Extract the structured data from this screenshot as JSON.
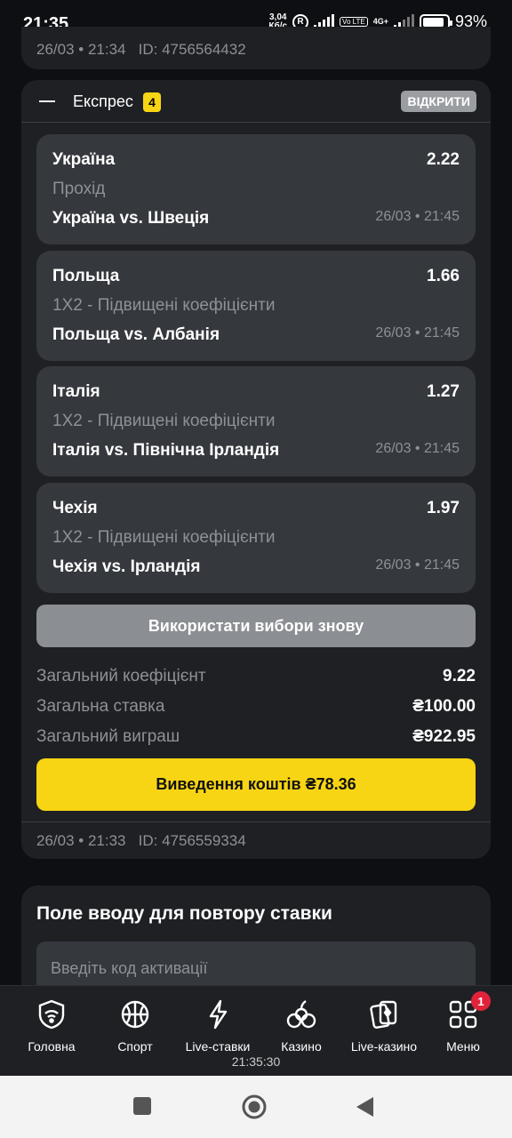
{
  "status_bar": {
    "time": "21:35",
    "speed_value": "3,04",
    "speed_unit": "Кб/с",
    "volte": "Vo LTE",
    "network": "4G+",
    "battery": "93%"
  },
  "previous_bet": {
    "date": "26/03 • 21:34",
    "id": "ID: 4756564432"
  },
  "express_card": {
    "title": "Експрес",
    "count": "4",
    "open_label": "ВІДКРИТИ",
    "selections": [
      {
        "team": "Україна",
        "odds": "2.22",
        "market": "Прохід",
        "match": "Україна vs. Швеція",
        "date": "26/03 • 21:45"
      },
      {
        "team": "Польща",
        "odds": "1.66",
        "market": "1X2 - Підвищені коефіцієнти",
        "match": "Польща vs. Албанія",
        "date": "26/03 • 21:45"
      },
      {
        "team": "Італія",
        "odds": "1.27",
        "market": "1X2 - Підвищені коефіцієнти",
        "match": "Італія vs. Північна Ірландія",
        "date": "26/03 • 21:45"
      },
      {
        "team": "Чехія",
        "odds": "1.97",
        "market": "1X2 - Підвищені коефіцієнти",
        "match": "Чехія vs. Ірландія",
        "date": "26/03 • 21:45"
      }
    ],
    "reuse_label": "Використати вибори знову",
    "summary": {
      "total_odds_label": "Загальний коефіцієнт",
      "total_odds_value": "9.22",
      "total_stake_label": "Загальна ставка",
      "total_stake_value": "₴100.00",
      "total_win_label": "Загальний виграш",
      "total_win_value": "₴922.95"
    },
    "cashout_label": "Виведення коштів ₴78.36",
    "date": "26/03 • 21:33",
    "id": "ID: 4756559334"
  },
  "promo": {
    "title": "Поле вводу для повтору ставки",
    "placeholder": "Введіть код активації"
  },
  "bottom_nav": {
    "items": [
      {
        "label": "Головна",
        "icon": "home-shield-icon"
      },
      {
        "label": "Спорт",
        "icon": "basketball-icon"
      },
      {
        "label": "Live-ставки",
        "icon": "lightning-icon"
      },
      {
        "label": "Казино",
        "icon": "cherries-icon"
      },
      {
        "label": "Live-казино",
        "icon": "cards-icon"
      },
      {
        "label": "Меню",
        "icon": "grid-menu-icon"
      }
    ],
    "menu_badge": "1",
    "clock": "21:35:30"
  },
  "colors": {
    "accent": "#f7d514",
    "card_bg": "#1e2024",
    "selection_bg": "#35383d",
    "badge_red": "#e0233b"
  }
}
